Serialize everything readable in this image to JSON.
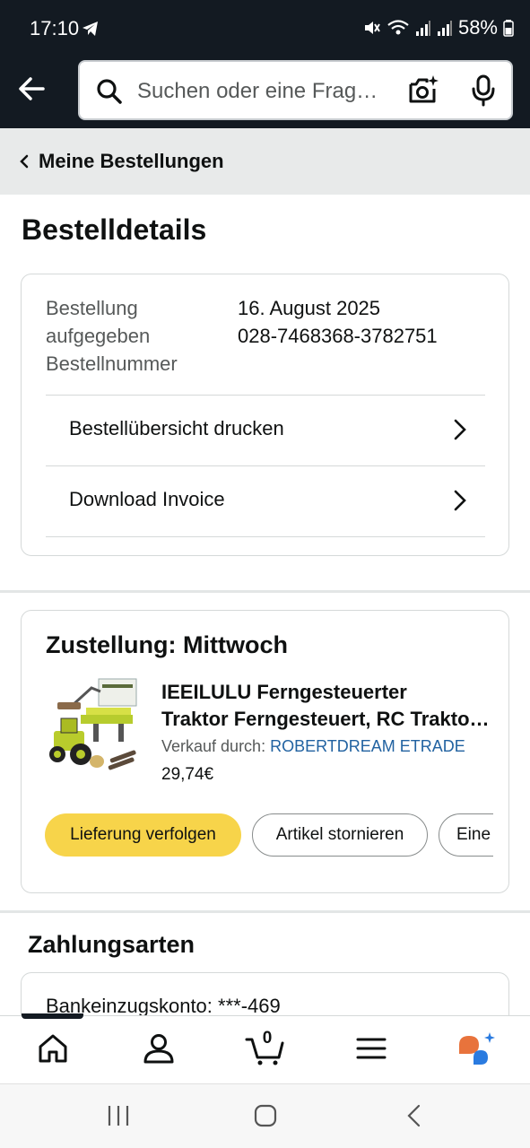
{
  "status_bar": {
    "time": "17:10",
    "battery": "58%"
  },
  "search": {
    "placeholder": "Suchen oder eine Frag…"
  },
  "breadcrumb": {
    "label": "Meine Bestellungen"
  },
  "page": {
    "title": "Bestelldetails"
  },
  "order": {
    "placed_label_line1": "Bestellung",
    "placed_label_line2": "aufgegeben",
    "number_label": "Bestellnummer",
    "placed_date": "16. August 2025",
    "order_number": "028-7468368-3782751",
    "rows": [
      {
        "label": "Bestellübersicht drucken"
      },
      {
        "label": "Download Invoice"
      }
    ]
  },
  "delivery": {
    "title": "Zustellung: Mittwoch",
    "product": {
      "title_line1": "IEEILULU Ferngesteuerter",
      "title_line2": "Traktor Ferngesteuert, RC Traktor Ferngesteuert mit Anhänger",
      "sold_by_label": "Verkauf durch: ",
      "seller": "ROBERTDREAM ETRADE",
      "price": "29,74€"
    },
    "buttons": {
      "track": "Lieferung verfolgen",
      "cancel": "Artikel stornieren",
      "more": "Eine"
    }
  },
  "payment": {
    "title": "Zahlungsarten",
    "account": "Bankeinzugskonto: ***-469"
  },
  "bottom_nav": {
    "cart_count": "0",
    "items": [
      "home-icon",
      "account-icon",
      "cart-icon",
      "menu-icon",
      "rufus-icon"
    ]
  },
  "colors": {
    "header_bg": "#131a22",
    "primary_button": "#f7d44a",
    "link": "#2162a1",
    "breadcrumb_bg": "#e8eaea"
  }
}
